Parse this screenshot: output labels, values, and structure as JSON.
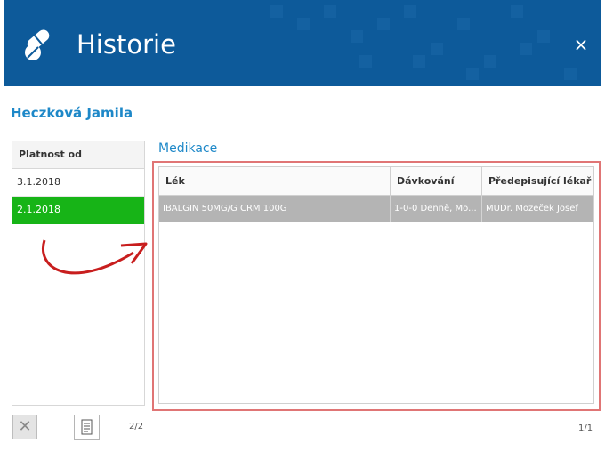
{
  "window": {
    "title": "Historie",
    "close_glyph": "×",
    "accent": "#0d5a9a"
  },
  "patient": {
    "name": "Heczková Jamila"
  },
  "validity": {
    "header": "Platnost od",
    "items": [
      {
        "date": "3.1.2018",
        "selected": false
      },
      {
        "date": "2.1.2018",
        "selected": true
      }
    ],
    "pager": "2/2"
  },
  "buttons": {
    "delete_glyph": "✕",
    "delete_icon": "close-icon",
    "doc_icon": "document-icon"
  },
  "medication": {
    "title": "Medikace",
    "columns": [
      "Lék",
      "Dávkování",
      "Předepisující lékař"
    ],
    "rows": [
      {
        "drug": "IBALGIN 50MG/G CRM 100G",
        "dosage": "1-0-0 Denně, Mo...",
        "doctor": "MUDr. Mozeček Josef"
      }
    ],
    "pager": "1/1",
    "highlight_color": "#e07575",
    "selected_color": "#17b417"
  }
}
